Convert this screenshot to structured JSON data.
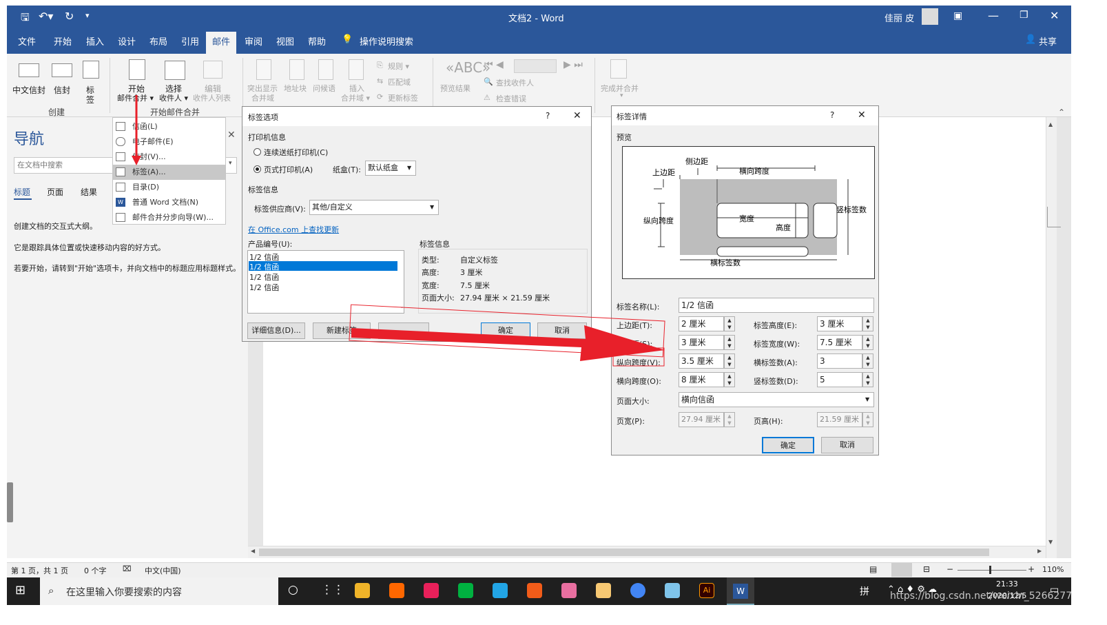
{
  "titlebar": {
    "doc_title": "文档2",
    "app_name": "Word",
    "title_sep": " - ",
    "user": "佳丽 皮"
  },
  "menu_tabs": [
    "文件",
    "开始",
    "插入",
    "设计",
    "布局",
    "引用",
    "邮件",
    "审阅",
    "视图",
    "帮助"
  ],
  "tell_me": "操作说明搜索",
  "share": "共享",
  "ribbon": {
    "create": {
      "btn1": "中文信封",
      "btn2": "信封",
      "btn3_top": "标",
      "btn3_bot": "签",
      "group": "创建"
    },
    "start": {
      "btn1_top": "开始",
      "btn1_bot": "邮件合并 ▾",
      "btn2_top": "选择",
      "btn2_bot": "收件人 ▾",
      "btn3_top": "编辑",
      "btn3_bot": "收件人列表",
      "group": "开始邮件合并"
    },
    "write": {
      "hl_top": "突出显示",
      "hl_bot": "合并域",
      "addr": "地址块",
      "greet": "问候语",
      "ins_top": "插入",
      "ins_bot": "合并域 ▾",
      "rules": "规则 ▾",
      "match": "匹配域",
      "update": "更新标签"
    },
    "preview": {
      "btn": "预览结果",
      "find": "查找收件人",
      "check": "检查错误"
    },
    "finish": {
      "btn": "完成并合并",
      "arrow": "▾"
    }
  },
  "nav": {
    "title": "导航",
    "search_placeholder": "在文档中搜索",
    "tabs": [
      "标题",
      "页面",
      "结果"
    ],
    "p1": "创建文档的交互式大纲。",
    "p2": "它是跟踪具体位置或快速移动内容的好方式。",
    "p3": "若要开始，请转到\"开始\"选项卡，并向文档中的标题应用标题样式。"
  },
  "dropdown": {
    "items": [
      "信函(L)",
      "电子邮件(E)",
      "信封(V)...",
      "标签(A)...",
      "目录(D)",
      "普通 Word 文档(N)",
      "邮件合并分步向导(W)..."
    ]
  },
  "label_options": {
    "title": "标签选项",
    "help": "?",
    "printer_info": "打印机信息",
    "radio_continuous": "连续送纸打印机(C)",
    "radio_page": "页式打印机(A)",
    "tray_label": "纸盒(T):",
    "tray_value": "默认纸盒",
    "label_info_section": "标签信息",
    "vendor_label": "标签供应商(V):",
    "vendor_value": "其他/自定义",
    "office_link": "在 Office.com 上查找更新",
    "product_label": "产品编号(U):",
    "products": [
      "1/2 信函",
      "1/2 信函",
      "1/2 信函",
      "1/2 信函"
    ],
    "info_title": "标签信息",
    "info": [
      {
        "k": "类型:",
        "v": "自定义标签"
      },
      {
        "k": "高度:",
        "v": "3 厘米"
      },
      {
        "k": "宽度:",
        "v": "7.5 厘米"
      },
      {
        "k": "页面大小:",
        "v": "27.94 厘米 × 21.59 厘米"
      }
    ],
    "btn_details": "详细信息(D)...",
    "btn_new": "新建标签",
    "btn_ok": "确定",
    "btn_cancel": "取消"
  },
  "label_details": {
    "title": "标签详情",
    "help": "?",
    "preview": "预览",
    "diagram": {
      "top": "上边距",
      "side": "侧边距",
      "hpitch": "横向跨度",
      "vpitch": "纵向跨度",
      "width": "宽度",
      "height": "高度",
      "across": "横标签数",
      "down": "竖标签数"
    },
    "name_label": "标签名称(L):",
    "name_value": "1/2 信函",
    "top_margin": {
      "label": "上边距(T):",
      "value": "2 厘米"
    },
    "side_margin": {
      "label": "侧边距(S):",
      "value": "3 厘米"
    },
    "vpitch": {
      "label": "纵向跨度(V):",
      "value": "3.5 厘米"
    },
    "hpitch": {
      "label": "横向跨度(O):",
      "value": "8 厘米"
    },
    "label_height": {
      "label": "标签高度(E):",
      "value": "3 厘米"
    },
    "label_width": {
      "label": "标签宽度(W):",
      "value": "7.5 厘米"
    },
    "across": {
      "label": "横标签数(A):",
      "value": "3"
    },
    "down": {
      "label": "竖标签数(D):",
      "value": "5"
    },
    "page_size": {
      "label": "页面大小:",
      "value": "横向信函"
    },
    "page_width": {
      "label": "页宽(P):",
      "value": "27.94 厘米"
    },
    "page_height": {
      "label": "页高(H):",
      "value": "21.59 厘米"
    },
    "btn_ok": "确定",
    "btn_cancel": "取消"
  },
  "statusbar": {
    "page": "第 1 页，共 1 页",
    "words": "0 个字",
    "lang": "中文(中国)",
    "zoom": "110%"
  },
  "taskbar": {
    "search": "在这里输入你要搜索的内容",
    "ime": "拼",
    "time": "21:33",
    "date": "2020/12/5"
  },
  "watermark": "https://blog.csdn.net/weixin_52662777",
  "colors": {
    "word_blue": "#2b579a",
    "annotation_red": "#e8202a",
    "selection": "#0078d7"
  }
}
